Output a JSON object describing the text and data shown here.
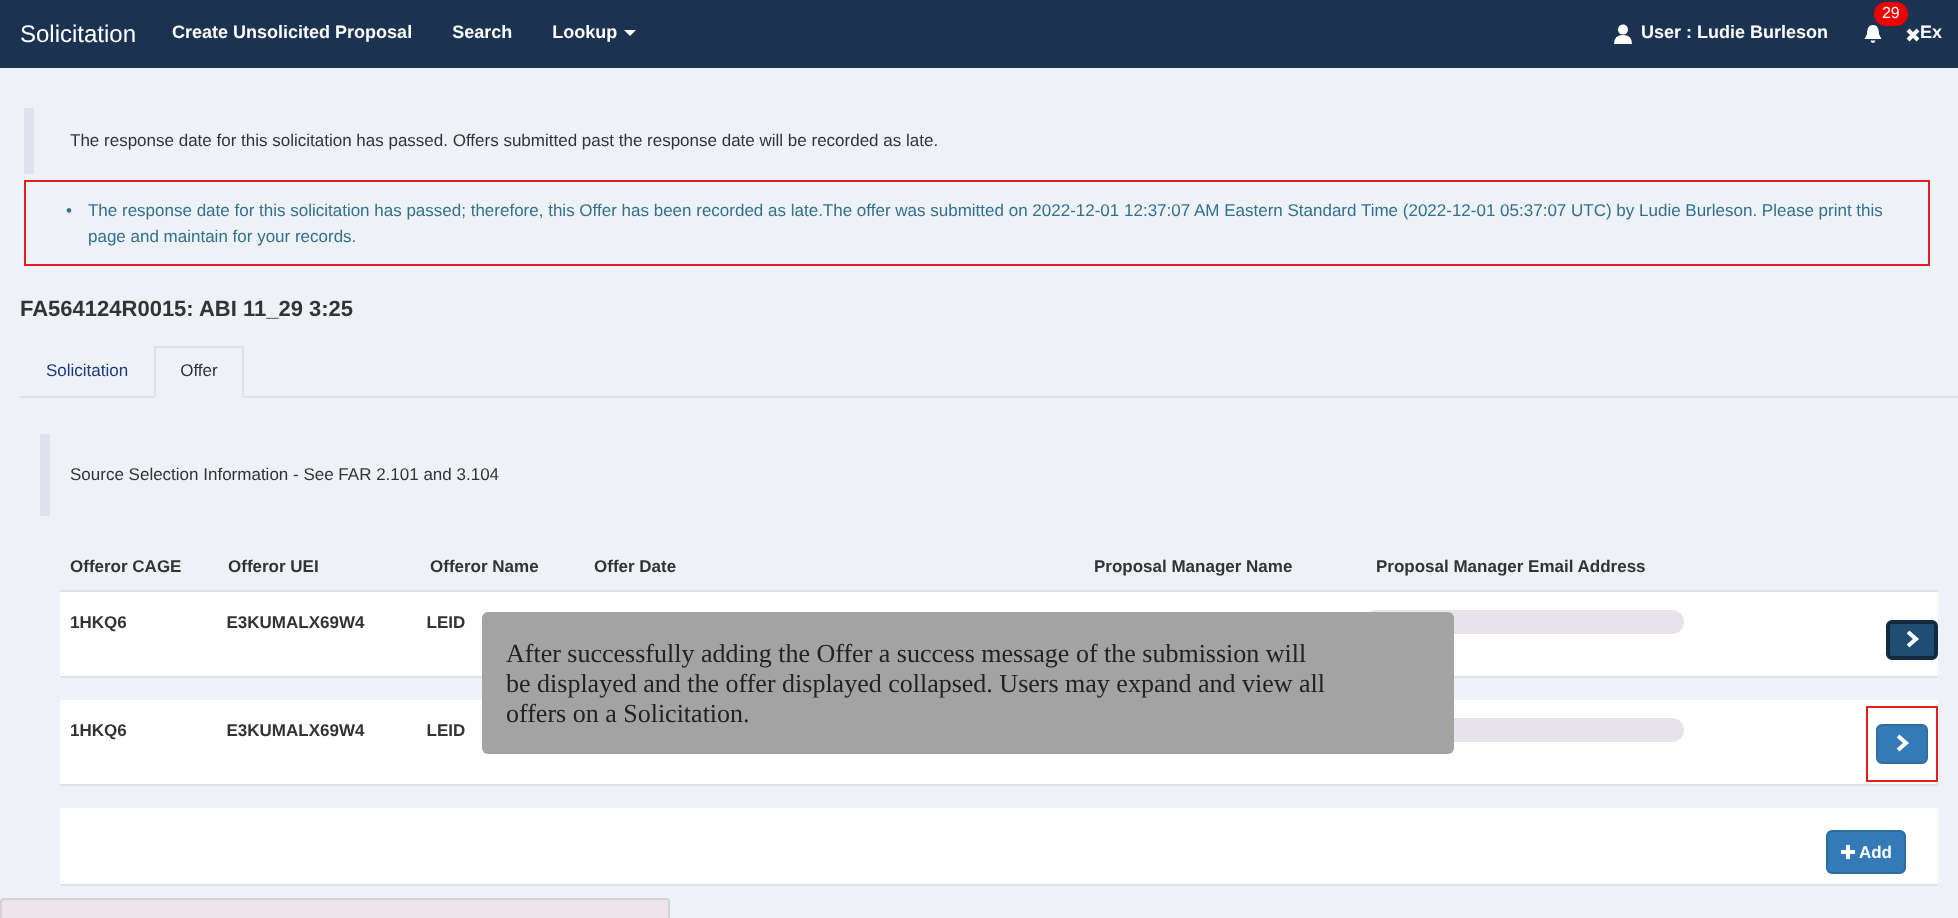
{
  "navbar": {
    "brand": "Solicitation",
    "links": [
      "Create Unsolicited Proposal",
      "Search"
    ],
    "dropdown": "Lookup",
    "user": "User : Ludie Burleson",
    "notification_count": "29",
    "exit": "Ex"
  },
  "alerts": [
    {
      "kind": "info",
      "text": "The response date for this solicitation has passed. Offers submitted past the response date will be recorded as late.",
      "highlighted": false
    },
    {
      "kind": "bullet",
      "marker": "•",
      "text": "The response date for this solicitation has passed; therefore, this Offer has been recorded as late.The offer was submitted on 2022-12-01 12:37:07 AM Eastern Standard Time (2022-12-01 05:37:07 UTC) by Ludie Burleson. Please print this page and maintain for your records.",
      "highlighted": true
    }
  ],
  "title": "FA564124R0015: ABI 11_29 3:25",
  "tabs": [
    {
      "label": "Solicitation",
      "selected": false
    },
    {
      "label": "Offer",
      "selected": true
    }
  ],
  "notice": "Source Selection Information - See FAR 2.101 and 3.104",
  "table": {
    "columns": [
      "Offeror CAGE",
      "Offeror UEI",
      "Offeror Name",
      "Offer Date",
      "Proposal Manager Name",
      "Proposal Manager Email Address"
    ],
    "rows": [
      {
        "cage": "1HKQ6",
        "uei": "E3KUMALX69W4",
        "name": "LEID",
        "focused": true,
        "highlighted": false
      },
      {
        "cage": "1HKQ6",
        "uei": "E3KUMALX69W4",
        "name": "LEID",
        "focused": false,
        "highlighted": true
      }
    ],
    "add_button": "Add"
  },
  "callout": "After successfully adding the Offer a success message of the submission will be displayed and the offer displayed collapsed. Users may expand and view all offers on a Solicitation."
}
